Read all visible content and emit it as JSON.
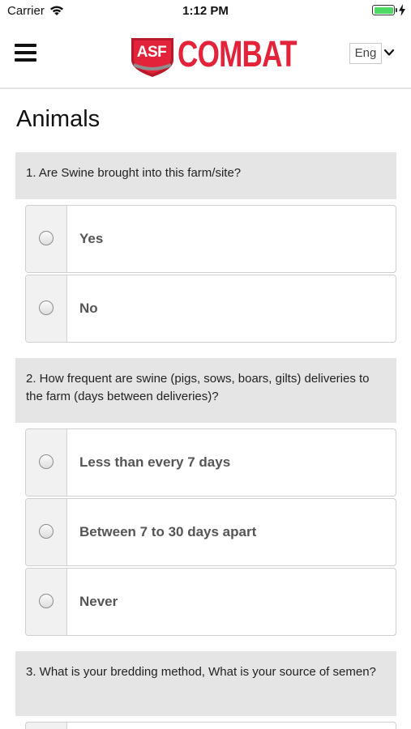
{
  "status_bar": {
    "carrier": "Carrier",
    "time": "1:12 PM",
    "battery_color": "#4cd964"
  },
  "header": {
    "menu_icon": "hamburger-icon",
    "logo": {
      "badge_text": "ASF",
      "word": "COMBAT",
      "brand_color": "#e2233a"
    },
    "language": {
      "selected": "Eng",
      "icon": "chevron-down-icon"
    }
  },
  "page": {
    "title": "Animals",
    "questions": [
      {
        "text": "1. Are Swine brought into this farm/site?",
        "options": [
          "Yes",
          "No"
        ]
      },
      {
        "text": "2. How frequent are swine (pigs, sows, boars, gilts) deliveries to the farm (days between deliveries)?",
        "options": [
          "Less than every 7 days",
          "Between 7 to 30 days apart",
          "Never"
        ]
      },
      {
        "text": "3. What is your bredding method, What is your source of semen?",
        "options": [
          ""
        ]
      }
    ]
  }
}
